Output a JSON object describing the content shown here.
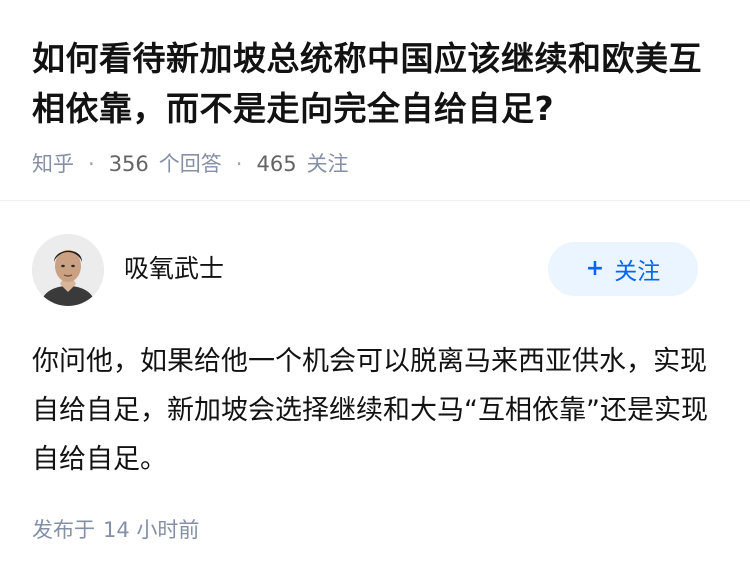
{
  "question": {
    "title": "如何看待新加坡总统称中国应该继续和欧美互相依靠，而不是走向完全自给自足?",
    "source": "知乎",
    "answer_count": "356",
    "answer_label": "个回答",
    "follower_count": "465",
    "follower_label": "关注"
  },
  "author": {
    "name": "吸氧武士",
    "avatar": "avatar-photo",
    "follow_label": "关注",
    "follow_icon": "plus-icon"
  },
  "answer": {
    "text": "你问他，如果给他一个机会可以脱离马来西亚供水，实现自给自足，新加坡会选择继续和大马“互相依靠”还是实现自给自足。",
    "published_label": "发布于",
    "published_time": "14 小时前"
  },
  "colors": {
    "title": "#121212",
    "meta": "#8590a6",
    "accent": "#0066ff",
    "follow_bg": "#ebf5ff"
  }
}
